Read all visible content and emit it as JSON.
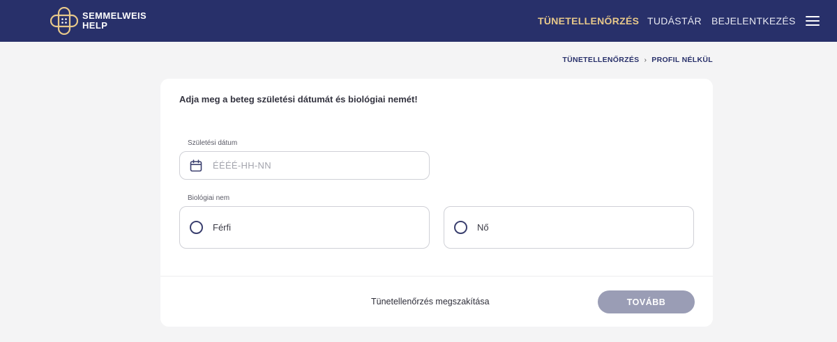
{
  "header": {
    "logo_line1": "SEMMELWEIS",
    "logo_line2": "HELP",
    "nav": [
      {
        "label": "TÜNETELLENŐRZÉS",
        "active": true
      },
      {
        "label": "TUDÁSTÁR",
        "active": false
      },
      {
        "label": "BEJELENTKEZÉS",
        "active": false
      }
    ],
    "menu_icon": "hamburger-icon"
  },
  "breadcrumb": {
    "items": [
      "TÜNETELLENŐRZÉS",
      "PROFIL NÉLKÜL"
    ],
    "separator": "›"
  },
  "form": {
    "title": "Adja meg a beteg születési dátumát és biológiai nemét!",
    "birthdate": {
      "label": "Születési dátum",
      "placeholder": "ÉÉÉÉ-HH-NN",
      "value": "",
      "icon": "calendar-icon"
    },
    "sex": {
      "label": "Biológiai nem",
      "options": [
        {
          "label": "Férfi",
          "selected": false
        },
        {
          "label": "Nő",
          "selected": false
        }
      ]
    }
  },
  "footer": {
    "cancel_label": "Tünetellenőrzés megszakítása",
    "next_label": "TOVÁBB"
  },
  "colors": {
    "header_bg": "#28306a",
    "nav_active": "#e7c88a",
    "button_disabled": "#9a9db5",
    "page_bg": "#f4f4f5"
  }
}
